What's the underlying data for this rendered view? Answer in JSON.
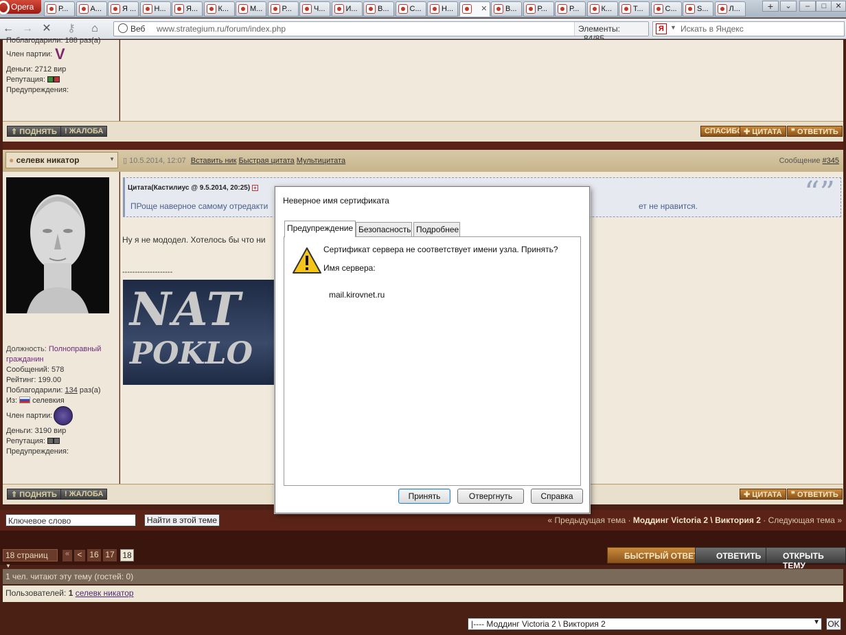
{
  "browser": {
    "opera_label": "Opera",
    "tabs": [
      {
        "label": "Р..."
      },
      {
        "label": "А..."
      },
      {
        "label": "Я ..."
      },
      {
        "label": "Н..."
      },
      {
        "label": "Я..."
      },
      {
        "label": "К..."
      },
      {
        "label": "М..."
      },
      {
        "label": "Р..."
      },
      {
        "label": "Ч..."
      },
      {
        "label": "И..."
      },
      {
        "label": "В..."
      },
      {
        "label": "С..."
      },
      {
        "label": "Н..."
      },
      {
        "label": ""
      },
      {
        "label": "В..."
      },
      {
        "label": "Р..."
      },
      {
        "label": "Р..."
      },
      {
        "label": "К..."
      },
      {
        "label": "Т..."
      },
      {
        "label": "С..."
      },
      {
        "label": "S..."
      },
      {
        "label": "Л..."
      }
    ],
    "active_tab_index": 13,
    "web_label": "Веб",
    "url": "www.strategium.ru/forum/index.php",
    "elements_label": "Элементы:",
    "elements_count": "84/85",
    "search_placeholder": "Искать в Яндекс"
  },
  "post1": {
    "thanks_line": "Поблагодарили: 188 раз(а)",
    "party_label": "Член партии:",
    "money": "Деньги: 2712 вир",
    "reputation_label": "Репутация:",
    "warnings_label": "Предупреждения:",
    "btn_up": "ПОДНЯТЬ",
    "btn_report": "ЖАЛОБА",
    "btn_thanks": "СПАСИБО",
    "btn_quote": "ЦИТАТА",
    "btn_reply": "ОТВЕТИТЬ"
  },
  "post2": {
    "author": "селевк никатор",
    "date": "10.5.2014, 12:07",
    "insert_nick": "Вставить ник",
    "quick_quote": "Быстрая цитата",
    "multi_quote": "Мультицитата",
    "message_label": "Сообщение",
    "message_num": "#345",
    "quote_header": "Цитата(Кастилиус @ 9.5.2014, 20:25)",
    "quote_text_left": "ПРоще наверное самому отредакти",
    "quote_text_right": "ет не нравится.",
    "body_text": "Ну я не мододел. Хотелось бы что ни",
    "separator": "--------------------",
    "banner_line1": "NAT",
    "banner_line2": "POKLO",
    "rank_label": "Должность:",
    "rank_value": "Полноправный гражданин",
    "posts": "Сообщений: 578",
    "rating": "Рейтинг: 199.00",
    "thanks_prefix": "Поблагодарили:",
    "thanks_count": "134",
    "thanks_suffix": "раз(а)",
    "from_label": "Из:",
    "from_value": "селевкия",
    "party_label": "Член партии:",
    "money": "Деньги: 3190 вир",
    "reputation_label": "Репутация:",
    "warnings_label": "Предупреждения:",
    "btn_up": "ПОДНЯТЬ",
    "btn_report": "ЖАЛОБА",
    "btn_quote": "ЦИТАТА",
    "btn_reply": "ОТВЕТИТЬ"
  },
  "search": {
    "value": "Ключевое слово",
    "button": "Найти в этой теме"
  },
  "topic_nav": {
    "prev": "« Предыдущая тема",
    "current": "Моддинг Victoria 2 \\ Виктория 2",
    "next": "Следующая тема »"
  },
  "pagination": {
    "pages_label": "18 страниц",
    "first": "«",
    "prev": "<",
    "pages": [
      "16",
      "17",
      "18"
    ],
    "current": "18"
  },
  "actions": {
    "quick_reply": "БЫСТРЫЙ ОТВЕТ",
    "reply": "ОТВЕТИТЬ",
    "new_topic": "ОТКРЫТЬ ТЕМУ"
  },
  "readers": {
    "line": "1 чел. читают эту тему (гостей: 0)",
    "users_label": "Пользователей:",
    "users_count": "1",
    "user_name": "селевк никатор"
  },
  "jump": {
    "selected": "|---- Моддинг Victoria 2 \\ Виктория 2",
    "ok": "OK"
  },
  "dialog": {
    "title": "Неверное имя сертификата",
    "tabs": [
      "Предупреждение",
      "Безопасность",
      "Подробнее"
    ],
    "message": "Сертификат сервера не соответствует имени узла. Принять?",
    "server_label": "Имя сервера:",
    "server_name": "mail.kirovnet.ru",
    "btn_accept": "Принять",
    "btn_reject": "Отвергнуть",
    "btn_help": "Справка"
  },
  "colors": {
    "forum_background": "#4a1f14",
    "post_panel": "#f0e9dc",
    "accent_brown": "#8a5219"
  }
}
